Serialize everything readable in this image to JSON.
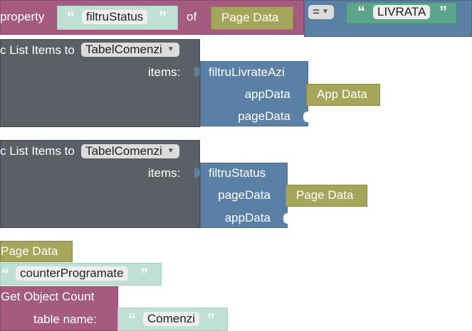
{
  "blocks": {
    "property_row": {
      "property_label": "property",
      "property_name": "filtruStatus",
      "of_label": "of",
      "source": "Page Data",
      "operator": "=",
      "compare_value": "LIVRATA"
    },
    "set_list_1": {
      "label": "c List Items to",
      "component": "TabelComenzi",
      "items_label": "items:",
      "items_block": "filtruLivrateAzi",
      "param1_label": "appData",
      "param1_value": "App Data",
      "param2_label": "pageData"
    },
    "set_list_2": {
      "label": "c List Items to",
      "component": "TabelComenzi",
      "items_label": "items:",
      "items_block": "filtruStatus",
      "param1_label": "pageData",
      "param1_value": "Page Data",
      "param2_label": "appData"
    },
    "page_data_block": "Page Data",
    "counter_string": "counterProgramate",
    "get_count": {
      "label": "Get Object Count",
      "table_label": "table name:",
      "table_value": "Comenzi"
    }
  },
  "colors": {
    "property": "#a55b80",
    "procedure": "#5b80a5",
    "component": "#5b5f66",
    "data": "#a5a55b",
    "string_green": "#5ba58c",
    "string_light": "#c0e0d5"
  }
}
